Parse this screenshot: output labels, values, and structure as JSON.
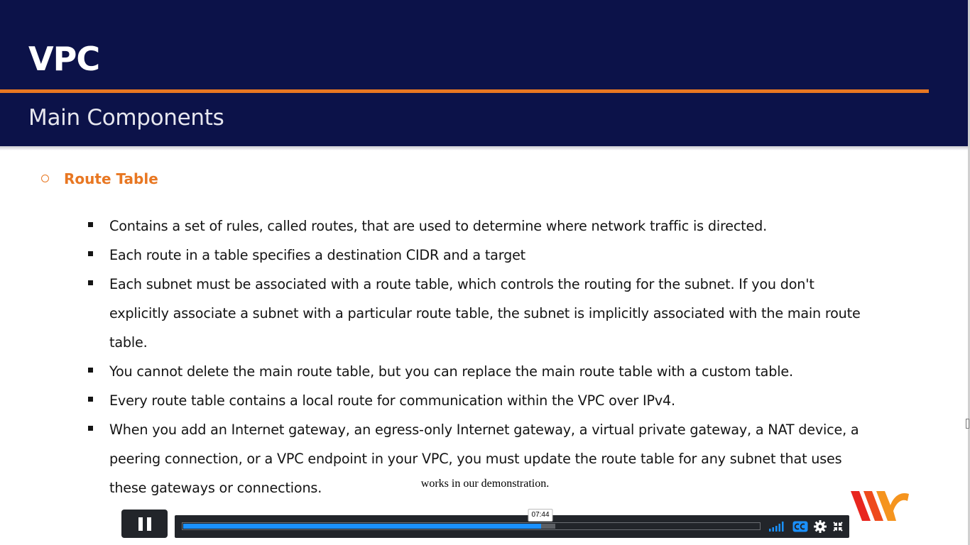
{
  "slide": {
    "title": "VPC",
    "subtitle": "Main Components",
    "section_heading": "Route Table",
    "bullets": [
      "Contains a set of rules, called routes, that are used to determine where network traffic is directed.",
      "Each route in a table specifies a destination CIDR and a target",
      "Each subnet must be associated with a route table, which controls the routing for the subnet. If you don't explicitly associate a subnet with a particular route table, the subnet is implicitly associated with the main route table.",
      "You cannot delete the main route table, but you can replace the main route table with a custom table.",
      "Every route table contains a local route for communication within the VPC over IPv4.",
      "When you add an Internet gateway, an egress-only Internet gateway, a virtual private gateway, a NAT device, a peering connection, or a VPC endpoint in your VPC, you must update the route table for any subnet that uses these gateways or connections."
    ]
  },
  "caption": "works in our demonstration.",
  "player": {
    "current_time": "07:44",
    "progress_fraction": 0.62,
    "buffered_fraction": 0.645,
    "state": "playing",
    "icons": [
      "pause-icon",
      "volume-icon",
      "captions-icon",
      "settings-icon",
      "fullscreen-icon"
    ]
  },
  "colors": {
    "header_bg": "#0c1249",
    "accent": "#e87722",
    "progress": "#1a91ff",
    "logo_red": "#e8261f",
    "logo_orange": "#f5941e"
  }
}
